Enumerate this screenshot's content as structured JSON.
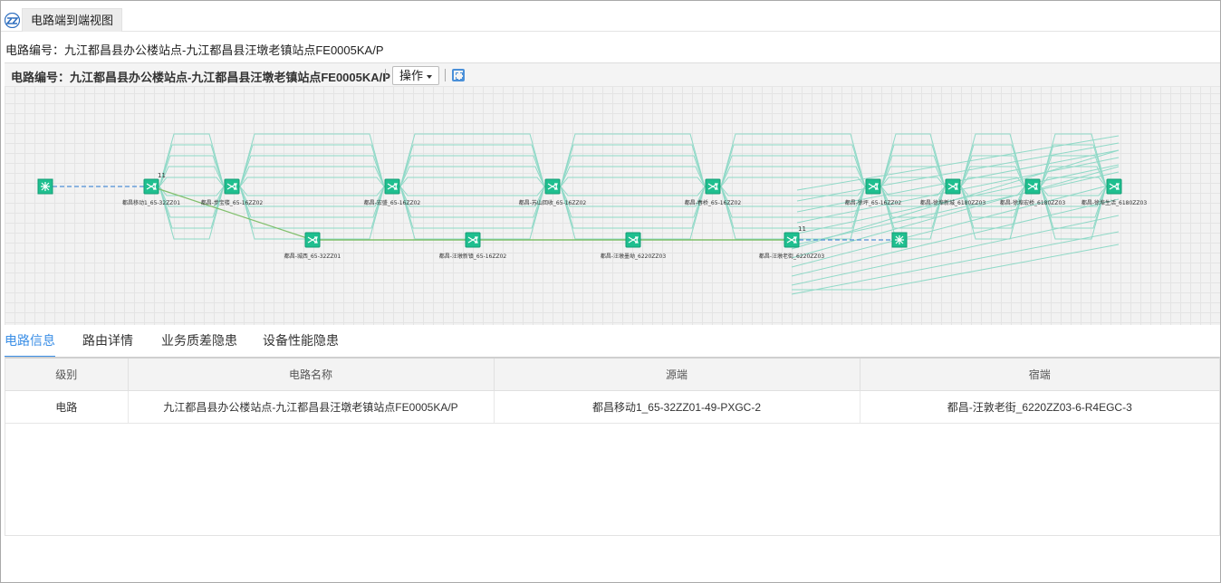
{
  "window": {
    "title": "电路端到端视图"
  },
  "circuit": {
    "label": "电路编号：九江都昌县办公楼站点-九江都昌县汪墩老镇站点FE0005KA/P"
  },
  "topology": {
    "title": "电路编号：九江都昌县办公楼站点-九江都昌县汪墩老镇站点FE0005KA/P",
    "operate_label": "操作",
    "fullscreen_icon": "fullscreen-icon",
    "accent_color": "#1fbf8f",
    "link_color": "#8fd9c7",
    "dashed_color": "#4f8fd6",
    "nodes_top": [
      "都昌移动1_65-32ZZ01",
      "都昌-步宝楼_65-16ZZ02",
      "都昌-宏盛_65-16ZZ02",
      "都昌-苏山回收_65-16ZZ02",
      "都昌-春桥_65-16ZZ02",
      "都昌-徐坪_65-16ZZ02",
      "都昌-徐埠新城_6180ZZ03",
      "都昌-徐埠宏桥_6180ZZ03",
      "都昌-徐埠生活_6180ZZ03"
    ],
    "nodes_bottom": [
      "都昌-城西_65-32ZZ01",
      "都昌-汪墩新镇_65-16ZZ02",
      "都昌-汪墩墨坳_6220ZZ03",
      "都昌-汪墩老街_6220ZZ03"
    ],
    "badge_label": "11"
  },
  "tabs": [
    {
      "label": "电路信息",
      "active": true
    },
    {
      "label": "路由详情",
      "active": false
    },
    {
      "label": "业务质差隐患",
      "active": false
    },
    {
      "label": "设备性能隐患",
      "active": false
    }
  ],
  "table": {
    "columns": [
      "级别",
      "电路名称",
      "源端",
      "宿端"
    ],
    "rows": [
      [
        "电路",
        "九江都昌县办公楼站点-九江都昌县汪墩老镇站点FE0005KA/P",
        "都昌移动1_65-32ZZ01-49-PXGC-2",
        "都昌-汪敦老街_6220ZZ03-6-R4EGC-3"
      ]
    ]
  }
}
